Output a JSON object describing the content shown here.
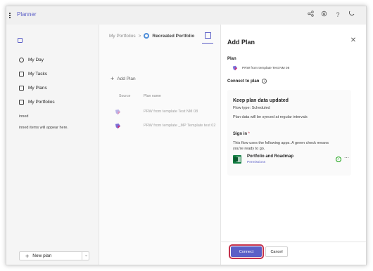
{
  "app": {
    "title": "Planner"
  },
  "topbar": {
    "icons": [
      "share-icon",
      "settings-icon",
      "help-icon",
      "feedback-icon"
    ],
    "help_glyph": "?"
  },
  "sidebar": {
    "items": [
      {
        "label": "My Day",
        "icon": "sun-icon"
      },
      {
        "label": "My Tasks",
        "icon": "tasks-icon"
      },
      {
        "label": "My Plans",
        "icon": "plans-icon"
      },
      {
        "label": "My Portfolios",
        "icon": "portfolio-icon"
      }
    ],
    "pinned_heading": "inned",
    "pinned_empty": "inned items will appear here.",
    "new_plan_label": "New plan"
  },
  "main": {
    "breadcrumb": {
      "parent": "My Portfolios",
      "separator": ">",
      "current": "Recreated Portfolio"
    },
    "add_plan_label": "Add Plan",
    "columns": {
      "source": "Source",
      "plan_name": "Plan name"
    },
    "rows": [
      {
        "name": "PRW from template Test NM 08"
      },
      {
        "name": "PRW from template _MP Template test 02"
      }
    ]
  },
  "panel": {
    "title": "Add Plan",
    "plan_label": "Plan",
    "plan_name": "PRW from template Test NM 08",
    "connect_label": "Connect to plan",
    "info_glyph": "i",
    "card": {
      "title": "Keep plan data updated",
      "flow_type": "Flow type: Scheduled",
      "sync_text": "Plan data will be synced at regular intervals",
      "signin_label": "Sign in",
      "required_mark": "*",
      "apps_text_1": "This flow uses the following apps. A green check means",
      "apps_text_2": "you're ready to go."
    },
    "connection": {
      "name": "Portfolio and Roadmap",
      "link": "Permissions",
      "status": "connected"
    },
    "buttons": {
      "connect": "Connect",
      "cancel": "Cancel"
    }
  },
  "colors": {
    "accent": "#5b5fc7",
    "success": "#13a10e",
    "excel": "#107c41",
    "highlight": "#c4314b"
  }
}
